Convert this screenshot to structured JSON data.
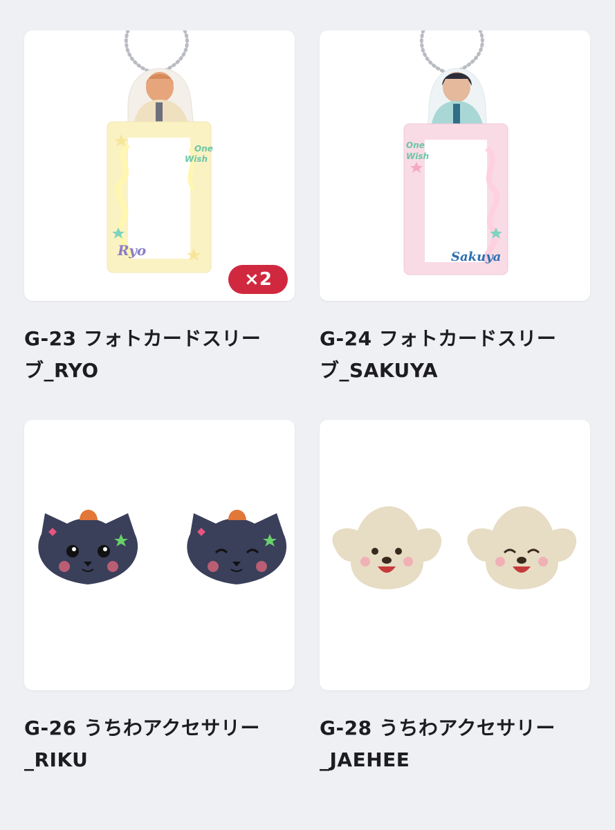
{
  "items": [
    {
      "code": "G-23",
      "line1": "G-23 フォトカードスリー",
      "line2": "ブ_RYO",
      "image_label": "Ryo",
      "qty_badge": "×2",
      "frame_color": "#fbf2c4",
      "glow_color": "#fff6b0"
    },
    {
      "code": "G-24",
      "line1": "G-24 フォトカードスリー",
      "line2": "ブ_SAKUYA",
      "image_label": "Sakuya",
      "qty_badge": "",
      "frame_color": "#f9dbe6",
      "glow_color": "#ffd0e0"
    },
    {
      "code": "G-26",
      "line1": "G-26 うちわアクセサリー",
      "line2": "_RIKU",
      "qty_badge": ""
    },
    {
      "code": "G-28",
      "line1": "G-28 うちわアクセサリー",
      "line2": "_JAEHEE",
      "qty_badge": ""
    }
  ],
  "colors": {
    "background": "#eff0f4",
    "badge": "#d0293f",
    "cat": "#3a3f5a",
    "dog": "#e7dcc4"
  }
}
